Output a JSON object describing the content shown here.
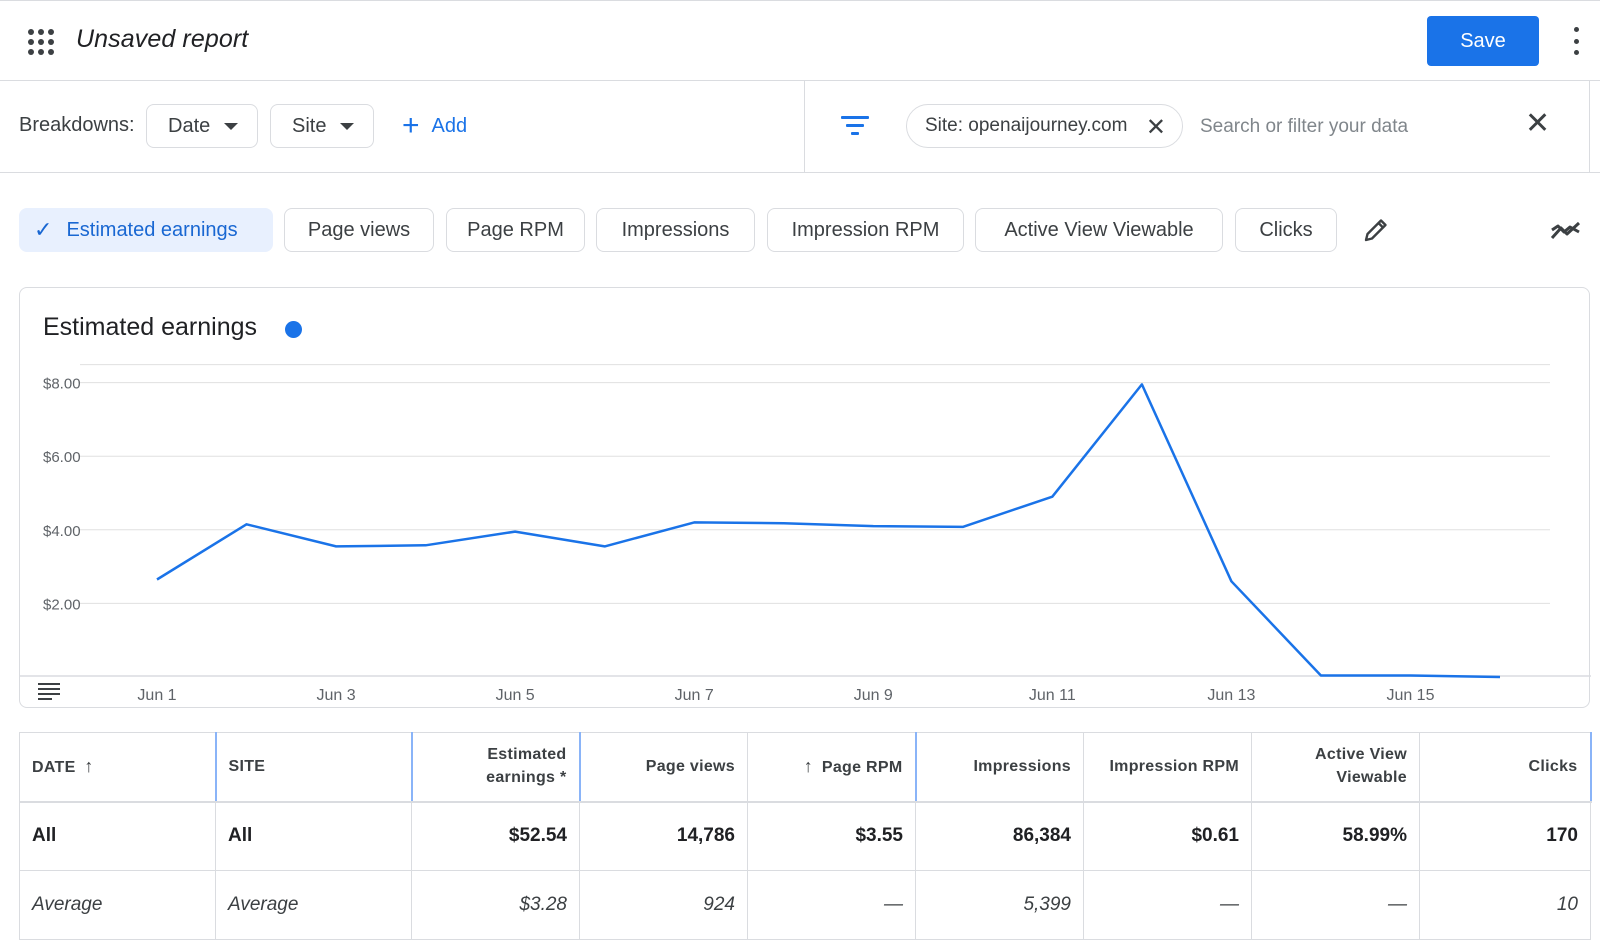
{
  "header": {
    "title": "Unsaved report",
    "save_label": "Save",
    "apps_icon": "apps-grid-icon",
    "more_icon": "more-vert-icon"
  },
  "breakdowns": {
    "label": "Breakdowns:",
    "dropdowns": [
      "Date",
      "Site"
    ],
    "add_label": "Add"
  },
  "filters": {
    "active_chip": "Site: openaijourney.com",
    "search_placeholder": "Search or filter your data"
  },
  "metrics": {
    "chips": [
      {
        "label": "Estimated earnings",
        "selected": true
      },
      {
        "label": "Page views",
        "selected": false
      },
      {
        "label": "Page RPM",
        "selected": false
      },
      {
        "label": "Impressions",
        "selected": false
      },
      {
        "label": "Impression RPM",
        "selected": false
      },
      {
        "label": "Active View Viewable",
        "selected": false
      },
      {
        "label": "Clicks",
        "selected": false
      }
    ]
  },
  "colors": {
    "accent": "#1a73e8",
    "selected_chip_bg": "#e8f0fe"
  },
  "chart_data": {
    "type": "line",
    "title": "Estimated earnings",
    "x": [
      "Jun 1",
      "Jun 2",
      "Jun 3",
      "Jun 4",
      "Jun 5",
      "Jun 6",
      "Jun 7",
      "Jun 8",
      "Jun 9",
      "Jun 10",
      "Jun 11",
      "Jun 12",
      "Jun 13",
      "Jun 14",
      "Jun 15",
      "Jun 16"
    ],
    "x_tick_labels": [
      "Jun 1",
      "Jun 3",
      "Jun 5",
      "Jun 7",
      "Jun 9",
      "Jun 11",
      "Jun 13",
      "Jun 15"
    ],
    "series": [
      {
        "values": [
          2.65,
          4.15,
          3.55,
          3.58,
          3.95,
          3.55,
          4.2,
          4.18,
          4.1,
          4.08,
          4.9,
          7.95,
          2.6,
          0.04,
          0.04,
          0.0
        ]
      }
    ],
    "y_ticks": [
      "$2.00",
      "$4.00",
      "$6.00",
      "$8.00"
    ],
    "ylim": [
      0,
      8.5
    ],
    "grid": true,
    "color": "#1a73e8"
  },
  "table": {
    "columns": [
      {
        "label": "DATE",
        "sort": "up-after"
      },
      {
        "label": "SITE"
      },
      {
        "label": "Estimated earnings *"
      },
      {
        "label": "Page views"
      },
      {
        "label": "Page RPM",
        "sort": "up-before"
      },
      {
        "label": "Impressions"
      },
      {
        "label": "Impression RPM"
      },
      {
        "label": "Active View Viewable"
      },
      {
        "label": "Clicks"
      }
    ],
    "rows": [
      {
        "type": "total",
        "cells": [
          "All",
          "All",
          "$52.54",
          "14,786",
          "$3.55",
          "86,384",
          "$0.61",
          "58.99%",
          "170"
        ]
      },
      {
        "type": "avg",
        "cells": [
          "Average",
          "Average",
          "$3.28",
          "924",
          "—",
          "5,399",
          "—",
          "—",
          "10"
        ]
      }
    ]
  }
}
